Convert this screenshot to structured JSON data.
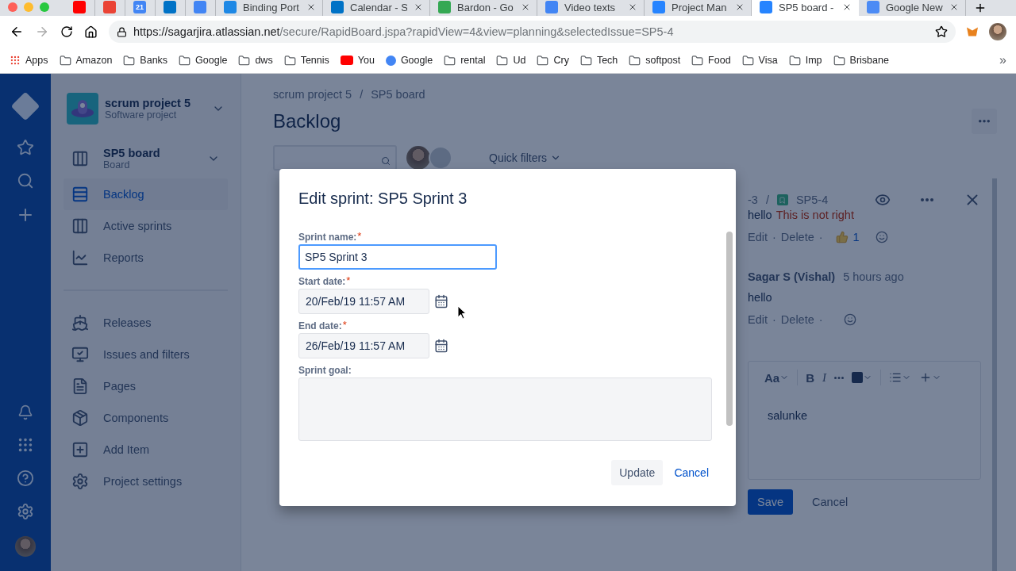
{
  "browser": {
    "tabs": [
      {
        "kind": "youtube",
        "selected": false
      },
      {
        "kind": "gmail",
        "selected": false
      },
      {
        "kind": "calendar",
        "icon_text": "21",
        "selected": false
      },
      {
        "kind": "outlook",
        "selected": false
      },
      {
        "kind": "docs",
        "selected": false
      },
      {
        "kind": "slash",
        "title": "Binding Port",
        "selected": false
      },
      {
        "kind": "outlook",
        "title": "Calendar - S",
        "selected": false
      },
      {
        "kind": "maps",
        "title": "Bardon - Go",
        "selected": false
      },
      {
        "kind": "docs",
        "title": "Video texts",
        "selected": false
      },
      {
        "kind": "jira",
        "title": "Project Man",
        "selected": false
      },
      {
        "kind": "jira",
        "title": "SP5 board -",
        "selected": true
      },
      {
        "kind": "news",
        "title": "Google New",
        "selected": false
      }
    ],
    "url": {
      "host": "https://sagarjira.atlassian.net",
      "path": "/secure/RapidBoard.jspa?rapidView=4&view=planning&selectedIssue=SP5-4"
    },
    "bookmarks": [
      {
        "kind": "apps",
        "label": "Apps"
      },
      {
        "kind": "folder",
        "label": "Amazon"
      },
      {
        "kind": "folder",
        "label": "Banks"
      },
      {
        "kind": "folder",
        "label": "Google"
      },
      {
        "kind": "folder",
        "label": "dws"
      },
      {
        "kind": "folder",
        "label": "Tennis"
      },
      {
        "kind": "youtube",
        "label": "You"
      },
      {
        "kind": "google",
        "label": "Google"
      },
      {
        "kind": "folder",
        "label": "rental"
      },
      {
        "kind": "folder",
        "label": "Ud"
      },
      {
        "kind": "folder",
        "label": "Cry"
      },
      {
        "kind": "folder",
        "label": "Tech"
      },
      {
        "kind": "folder",
        "label": "softpost"
      },
      {
        "kind": "folder",
        "label": "Food"
      },
      {
        "kind": "folder",
        "label": "Visa"
      },
      {
        "kind": "folder",
        "label": "Imp"
      },
      {
        "kind": "folder",
        "label": "Brisbane"
      }
    ],
    "more_bookmarks": "»"
  },
  "sidebar": {
    "project": {
      "name": "scrum project 5",
      "type": "Software project"
    },
    "board": {
      "name": "SP5 board",
      "type": "Board"
    },
    "items": [
      {
        "kind": "backlog",
        "label": "Backlog",
        "selected": true
      },
      {
        "kind": "sprints",
        "label": "Active sprints",
        "selected": false
      },
      {
        "kind": "reports",
        "label": "Reports",
        "selected": false
      }
    ],
    "project_items": [
      {
        "kind": "releases",
        "label": "Releases",
        "selected": false
      },
      {
        "kind": "issues",
        "label": "Issues and filters",
        "selected": false
      },
      {
        "kind": "pages",
        "label": "Pages",
        "selected": false
      },
      {
        "kind": "components",
        "label": "Components",
        "selected": false
      },
      {
        "kind": "add",
        "label": "Add Item",
        "selected": false
      },
      {
        "kind": "settings",
        "label": "Project settings",
        "selected": false
      }
    ]
  },
  "main": {
    "breadcrumbs": [
      "scrum project 5",
      "SP5 board"
    ],
    "separator": "/",
    "title": "Backlog",
    "quick_filters": "Quick filters"
  },
  "issue_panel": {
    "parent": "-3",
    "separator": "/",
    "key": "SP5-4",
    "comments": [
      {
        "text": "hello",
        "highlight": "This is not right",
        "actions": [
          "Edit",
          "Delete"
        ],
        "reactions": "1"
      },
      {
        "author": "Sagar S (Vishal)",
        "time": "5 hours ago",
        "text": "hello",
        "actions": [
          "Edit",
          "Delete"
        ]
      }
    ],
    "action_separator": "·",
    "editor": {
      "text_style": "Aa",
      "bold": "B",
      "italic": "I",
      "value": "salunke"
    },
    "save": "Save",
    "cancel": "Cancel"
  },
  "dialog": {
    "title": "Edit sprint: SP5 Sprint 3",
    "fields": [
      {
        "kind": "text",
        "label": "Sprint name:",
        "required_mark": "*",
        "value": "SP5 Sprint 3",
        "focused": true
      },
      {
        "kind": "date",
        "label": "Start date:",
        "required_mark": "*",
        "value": "20/Feb/19 11:57 AM"
      },
      {
        "kind": "date",
        "label": "End date:",
        "required_mark": "*",
        "value": "26/Feb/19 11:57 AM"
      },
      {
        "kind": "textarea",
        "label": "Sprint goal:"
      }
    ],
    "update": "Update",
    "cancel": "Cancel"
  }
}
